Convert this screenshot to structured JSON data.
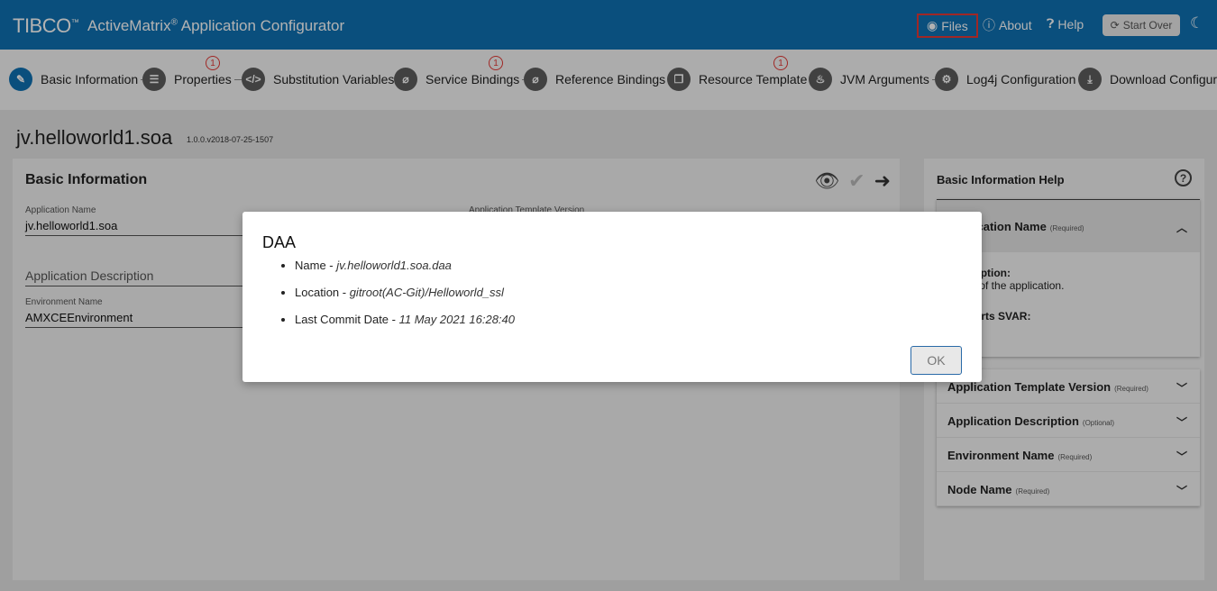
{
  "header": {
    "logo": "TIBCO",
    "logo_tm": "™",
    "product": "ActiveMatrix",
    "reg": "®",
    "product_suffix": " Application Configurator",
    "files": "Files",
    "about": "About",
    "help": "Help",
    "start_over": "Start Over"
  },
  "steps": [
    {
      "label": "Basic Information",
      "icon": "pencil-icon",
      "glyph": "✎",
      "badge": null
    },
    {
      "label": "Properties",
      "icon": "list-icon",
      "glyph": "☰",
      "badge": "1"
    },
    {
      "label": "Substitution Variables",
      "icon": "code-icon",
      "glyph": "</>",
      "badge": null
    },
    {
      "label": "Service Bindings",
      "icon": "paperclip-icon",
      "glyph": "⌀",
      "badge": "1"
    },
    {
      "label": "Reference Bindings",
      "icon": "paperclip-icon",
      "glyph": "⌀",
      "badge": null
    },
    {
      "label": "Resource Template",
      "icon": "copy-icon",
      "glyph": "❐",
      "badge": "1"
    },
    {
      "label": "JVM Arguments",
      "icon": "java-icon",
      "glyph": "♨",
      "badge": null
    },
    {
      "label": "Log4j Configuration",
      "icon": "gear-icon",
      "glyph": "⚙",
      "badge": null
    },
    {
      "label": "Download Configuration",
      "icon": "download-icon",
      "glyph": "⤓",
      "badge": null
    }
  ],
  "page": {
    "title": "jv.helloworld1.soa",
    "version": "1.0.0.v2018-07-25-1507"
  },
  "main": {
    "title": "Basic Information",
    "fields": {
      "app_name_label": "Application Name",
      "app_name_value": "jv.helloworld1.soa",
      "template_version_label": "Application Template Version",
      "app_desc_label": "Application Description",
      "env_name_label": "Environment Name",
      "env_name_value": "AMXCEEnvironment"
    }
  },
  "help": {
    "title": "Basic Information Help",
    "expanded": {
      "title": "Application Name",
      "tag": "(Required)",
      "desc_label": "Description:",
      "desc_text": "Name of the application.",
      "svar_label": "Supports SVAR:"
    },
    "items": [
      {
        "title": "Application Template Version",
        "tag": "(Required)"
      },
      {
        "title": "Application Description",
        "tag": "(Optional)"
      },
      {
        "title": "Environment Name",
        "tag": "(Required)"
      },
      {
        "title": "Node Name",
        "tag": "(Required)"
      }
    ]
  },
  "modal": {
    "title": "DAA",
    "items": [
      {
        "label": "Name - ",
        "value": "jv.helloworld1.soa.daa"
      },
      {
        "label": "Location - ",
        "value": "gitroot(AC-Git)/Helloworld_ssl"
      },
      {
        "label": "Last Commit Date - ",
        "value": "11 May 2021 16:28:40"
      }
    ],
    "ok": "OK"
  }
}
